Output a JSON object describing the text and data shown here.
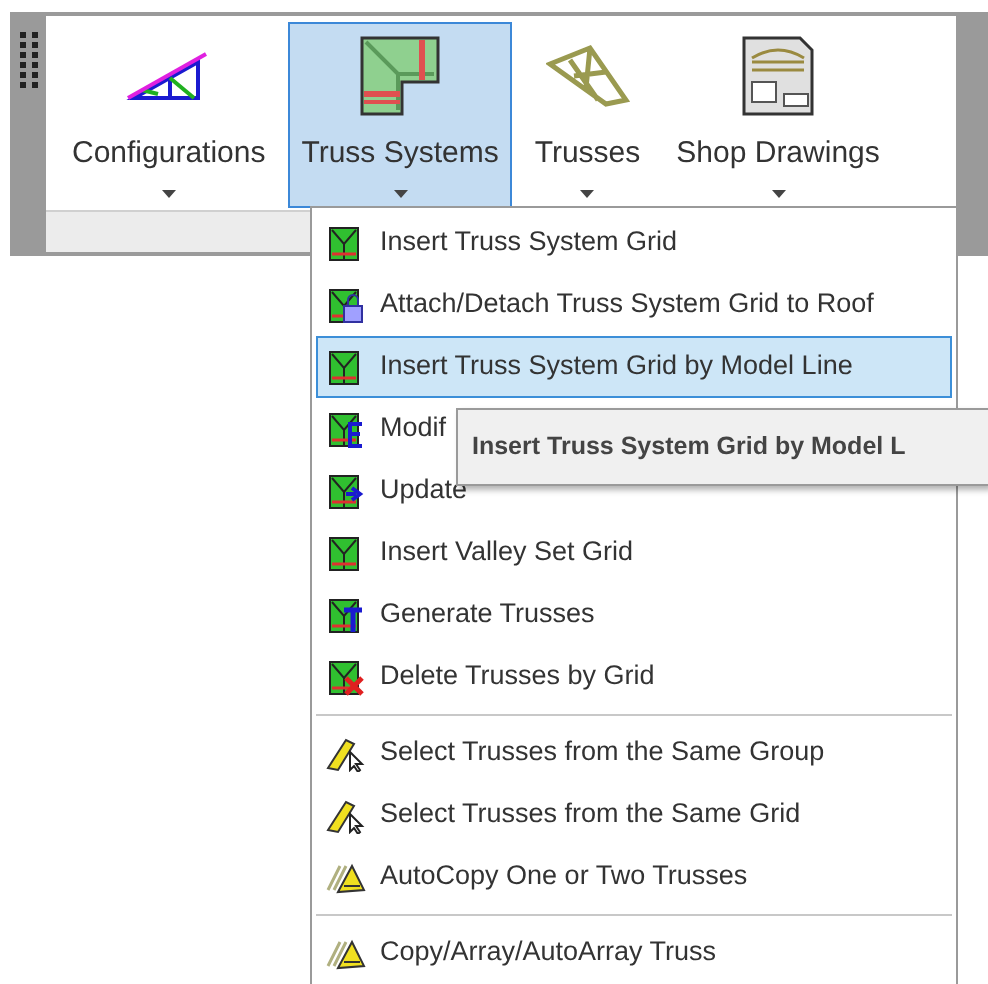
{
  "ribbon": {
    "buttons": [
      {
        "kind": "configurations",
        "label": "Configurations",
        "selected": false
      },
      {
        "kind": "truss-systems",
        "label": "Truss Systems",
        "selected": true
      },
      {
        "kind": "trusses",
        "label": "Trusses",
        "selected": false
      },
      {
        "kind": "shop-drawings",
        "label": "Shop Drawings",
        "selected": false
      }
    ]
  },
  "menu": {
    "groups": [
      [
        {
          "kind": "grid",
          "label": "Insert Truss System Grid",
          "selected": false
        },
        {
          "kind": "attach",
          "label": "Attach/Detach Truss System Grid to Roof",
          "selected": false
        },
        {
          "kind": "grid",
          "label": "Insert Truss System Grid by Model Line",
          "selected": true
        },
        {
          "kind": "modify",
          "label": "Modif",
          "selected": false
        },
        {
          "kind": "update",
          "label": "Update",
          "selected": false
        },
        {
          "kind": "grid",
          "label": "Insert Valley Set Grid",
          "selected": false
        },
        {
          "kind": "generate",
          "label": "Generate Trusses",
          "selected": false
        },
        {
          "kind": "delete",
          "label": "Delete Trusses by Grid",
          "selected": false
        }
      ],
      [
        {
          "kind": "select",
          "label": "Select Trusses from the Same Group",
          "selected": false
        },
        {
          "kind": "select",
          "label": "Select Trusses from the Same Grid",
          "selected": false
        },
        {
          "kind": "copy",
          "label": "AutoCopy One or Two Trusses",
          "selected": false
        }
      ],
      [
        {
          "kind": "copy",
          "label": "Copy/Array/AutoArray Truss",
          "selected": false
        }
      ]
    ]
  },
  "tooltip": {
    "text": "Insert Truss System Grid by Model L"
  }
}
